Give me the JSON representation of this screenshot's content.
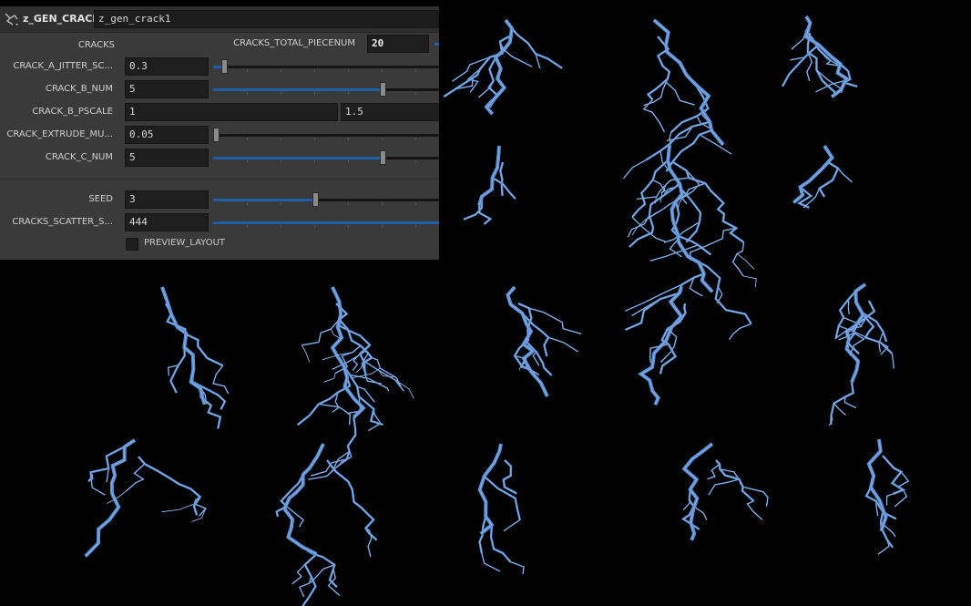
{
  "node": {
    "type_label": "z_GEN_CRACK",
    "name": "z_gen_crack1"
  },
  "params": {
    "cracks_folder": "CRACKS",
    "total_piecenum_label": "CRACKS_TOTAL_PIECENUM",
    "total_piecenum_value": "20",
    "crack_a_jitter_label": "CRACK_A_JITTER_SC...",
    "crack_a_jitter_value": "0.3",
    "crack_a_jitter_fraction": 0.05,
    "crack_b_num_label": "CRACK_B_NUM",
    "crack_b_num_value": "5",
    "crack_b_num_fraction": 0.75,
    "crack_b_pscale_label": "CRACK_B_PSCALE",
    "crack_b_pscale_value1": "1",
    "crack_b_pscale_value2": "1.5",
    "crack_extrude_label": "CRACK_EXTRUDE_MU...",
    "crack_extrude_value": "0.05",
    "crack_extrude_fraction": 0.01,
    "crack_c_num_label": "CRACK_C_NUM",
    "crack_c_num_value": "5",
    "crack_c_num_fraction": 0.75,
    "seed_label": "SEED",
    "seed_value": "3",
    "seed_fraction": 0.45,
    "scatter_label": "CRACKS_SCATTER_S...",
    "scatter_value": "444",
    "scatter_fraction": 1.0,
    "preview_layout_label": "PREVIEW_LAYOUT",
    "preview_layout_checked": false
  },
  "colors": {
    "crack_fill": "#5b8fd4",
    "crack_edge": "#dfeeff",
    "slider_fill": "#1f5fa8",
    "viewport_bg": "#000000"
  }
}
